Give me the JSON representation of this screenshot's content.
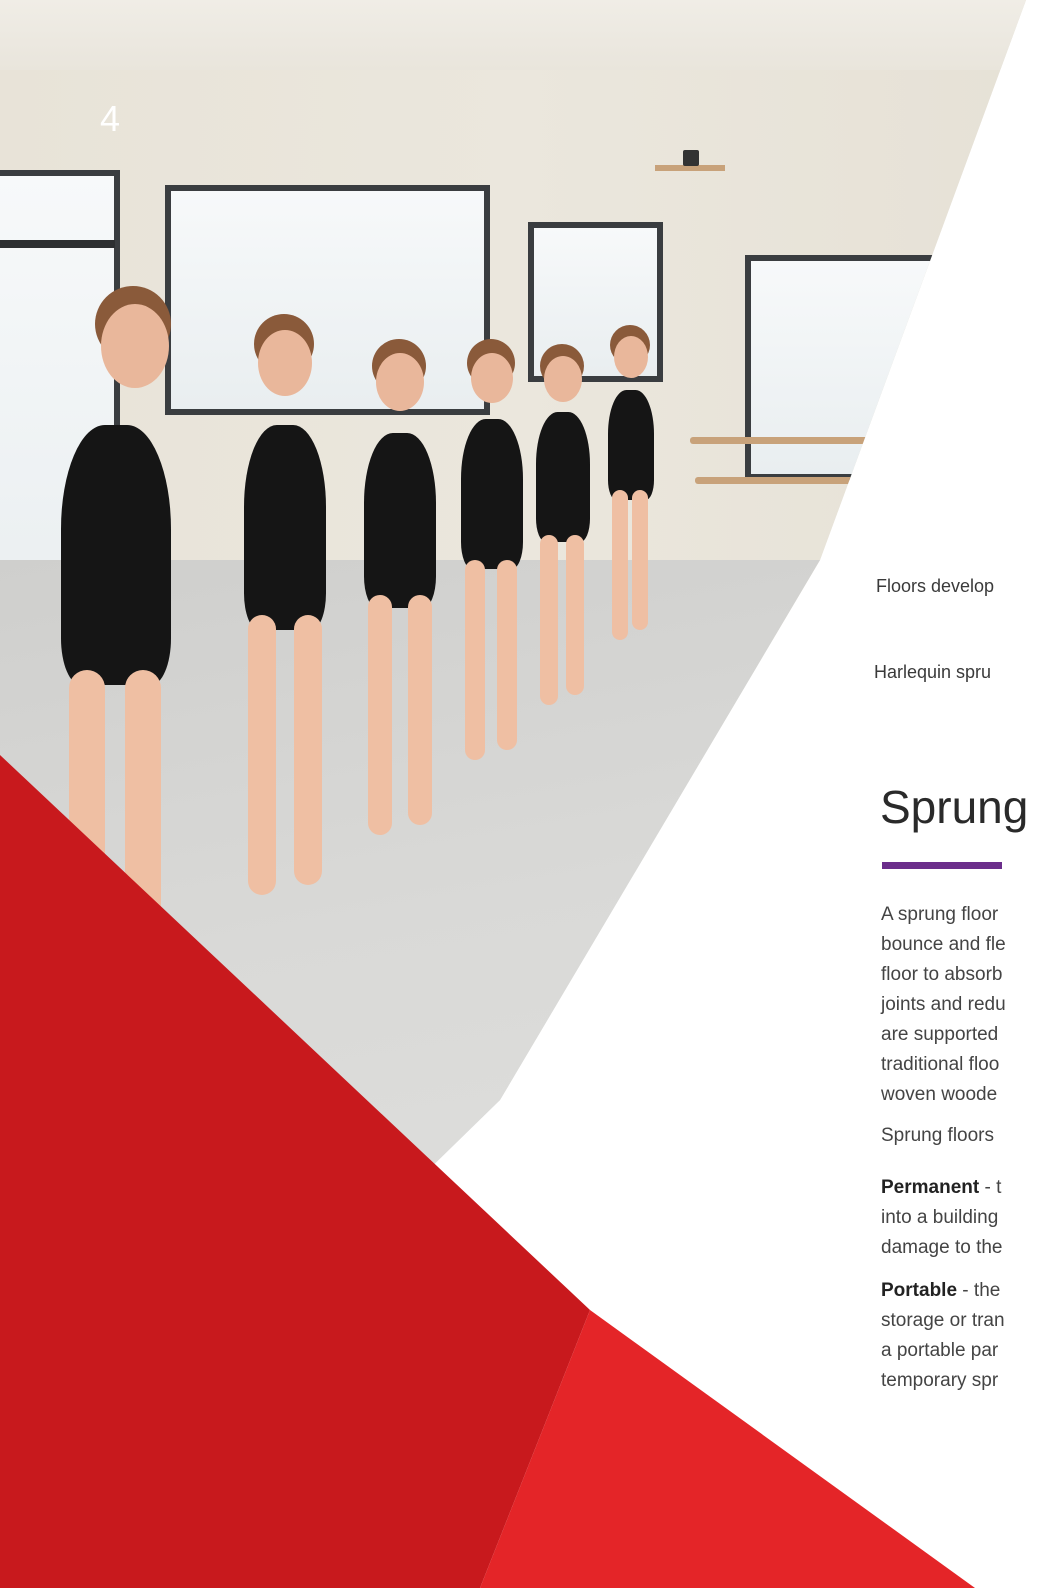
{
  "page": {
    "number": "4"
  },
  "notes": {
    "line1": "Floors develop",
    "line2": "Harlequin spru"
  },
  "section": {
    "heading": "Sprung",
    "accent_color": "#6b2d8b"
  },
  "body": {
    "intro_lines": [
      "A sprung floor",
      "bounce and fle",
      "floor to absorb",
      "joints and redu",
      "are supported",
      "traditional floo",
      "woven woode"
    ],
    "types_line": "Sprung floors",
    "permanent": {
      "label": "Permanent",
      "lines": [
        " - t",
        "into a building",
        "damage to the"
      ]
    },
    "portable": {
      "label": "Portable",
      "lines": [
        " - the",
        "storage or tran",
        "a portable par",
        "temporary spr"
      ]
    }
  },
  "colors": {
    "red_dark": "#c8191d",
    "red_bright": "#e42528",
    "purple": "#6b2d8b"
  },
  "image": {
    "description_icon": "ballet-class-photo"
  }
}
